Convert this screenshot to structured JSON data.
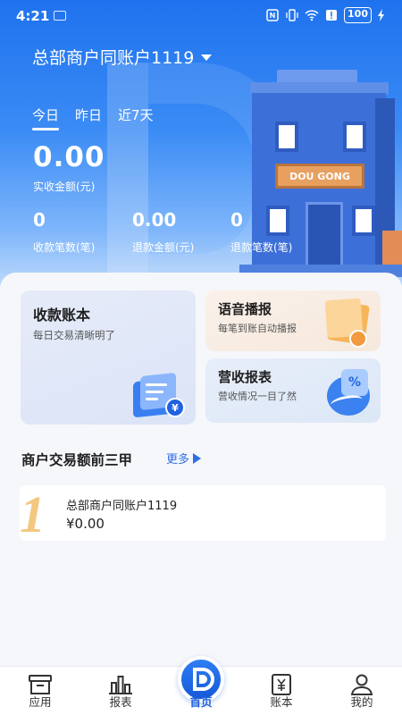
{
  "status_bar": {
    "time": "4:21",
    "battery": "100",
    "icons": [
      "notification-icon",
      "nfc-icon",
      "vibrate-icon",
      "wifi-icon",
      "alert-icon",
      "battery-icon",
      "charging-icon"
    ]
  },
  "header": {
    "account_name": "总部商户同账户1119"
  },
  "tabs": [
    {
      "label": "今日",
      "active": true
    },
    {
      "label": "昨日",
      "active": false
    },
    {
      "label": "近7天",
      "active": false
    }
  ],
  "summary": {
    "actual_amount": "0.00",
    "actual_amount_label": "实收金额(元)",
    "collect_count": "0",
    "collect_count_label": "收款笔数(笔)",
    "refund_amount": "0.00",
    "refund_amount_label": "退款金额(元)",
    "refund_count": "0",
    "refund_count_label": "退款笔数(笔)"
  },
  "building_sign": "DOU GONG",
  "cards": {
    "ledger": {
      "title": "收款账本",
      "subtitle": "每日交易清晰明了"
    },
    "voice": {
      "title": "语音播报",
      "subtitle": "每笔到账自动播报"
    },
    "report": {
      "title": "营收报表",
      "subtitle": "营收情况一目了然"
    },
    "ledger_icon_symbol": "¥",
    "report_icon_symbol": "%"
  },
  "ranking": {
    "title": "商户交易额前三甲",
    "more_label": "更多",
    "items": [
      {
        "rank": "1",
        "name": "总部商户同账户1119",
        "amount": "¥0.00"
      }
    ]
  },
  "nav": [
    {
      "label": "应用",
      "icon": "box-icon",
      "active": false
    },
    {
      "label": "报表",
      "icon": "bar-chart-icon",
      "active": false
    },
    {
      "label": "首页",
      "icon": "home-logo-icon",
      "active": true
    },
    {
      "label": "账本",
      "icon": "ledger-icon",
      "active": false
    },
    {
      "label": "我的",
      "icon": "user-icon",
      "active": false
    }
  ],
  "colors": {
    "brand_blue": "#1f63e0",
    "hero_top": "#1f72ee",
    "rank_gold": "#f3c77f"
  }
}
